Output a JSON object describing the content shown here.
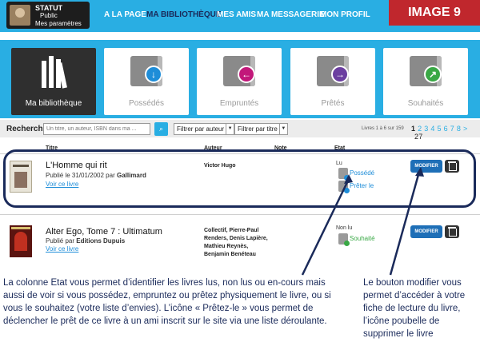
{
  "header": {
    "statut_title": "STATUT",
    "statut_public": "Public",
    "statut_params": "Mes paramètres",
    "nav": [
      "A LA PAGE",
      "MA BIBLIOTHÈQUE",
      "MES AMIS",
      "MA MESSAGERIE",
      "MON PROFIL"
    ],
    "active_nav": "MA BIBLIOTHÈQUE",
    "badge": "IMAGE 9"
  },
  "categories": [
    {
      "label": "Ma bibliothèque",
      "icon": "bookshelf-icon",
      "active": true
    },
    {
      "label": "Possédés",
      "icon": "download-book-icon",
      "accent": "#1e8dd8"
    },
    {
      "label": "Empruntés",
      "icon": "borrowed-book-icon",
      "accent": "#c2187a"
    },
    {
      "label": "Prêtés",
      "icon": "lent-book-icon",
      "accent": "#6b3fa0"
    },
    {
      "label": "Souhaités",
      "icon": "wished-book-icon",
      "accent": "#39a845"
    }
  ],
  "search": {
    "label": "Rechercher",
    "placeholder": "Un titre, un auteur, ISBN dans ma ...",
    "filter_author": "Filtrer par auteur",
    "filter_title": "Filtrer par titre",
    "range": "Livres 1 à 6 sur 159",
    "pages": [
      "1",
      "2",
      "3",
      "4",
      "5",
      "6",
      "7",
      "8",
      ">",
      "27"
    ]
  },
  "columns": {
    "titre": "Titre",
    "auteur": "Auteur",
    "note": "Note",
    "etat": "Etat"
  },
  "books": [
    {
      "title": "L'Homme qui rit",
      "published_prefix": "Publié le 31/01/2002 par ",
      "publisher": "Gallimard",
      "link": "Voir ce livre",
      "author": "Victor Hugo",
      "state": "Lu",
      "status_items": [
        "Possédé",
        "Prêter le"
      ],
      "modify": "MODIFIER"
    },
    {
      "title": "Alter Ego, Tome 7 : Ultimatum",
      "published_prefix": "Publié par ",
      "publisher": "Editions Dupuis",
      "link": "Voir ce livre",
      "author": "Collectif, Pierre-Paul Renders, Denis Lapière, Mathieu Reynès, Benjamin Benéteau",
      "state": "Non lu",
      "status_items": [
        "Souhaité"
      ],
      "modify": "MODIFIER"
    }
  ],
  "annotations": {
    "left": "La colonne Etat vous permet d’identifier les livres lus, non lus ou en-cours mais aussi de voir si vous possédez, empruntez ou prêtez physiquement le livre, ou si vous le souhaitez (votre liste d’envies). L’icône « Prêtez-le » vous permet de déclencher le prêt de ce livre à un ami inscrit sur le site via une liste déroulante.",
    "right": "Le bouton modifier vous permet d’accéder à votre fiche de lecture du livre, l’icône poubelle de supprimer le livre"
  }
}
